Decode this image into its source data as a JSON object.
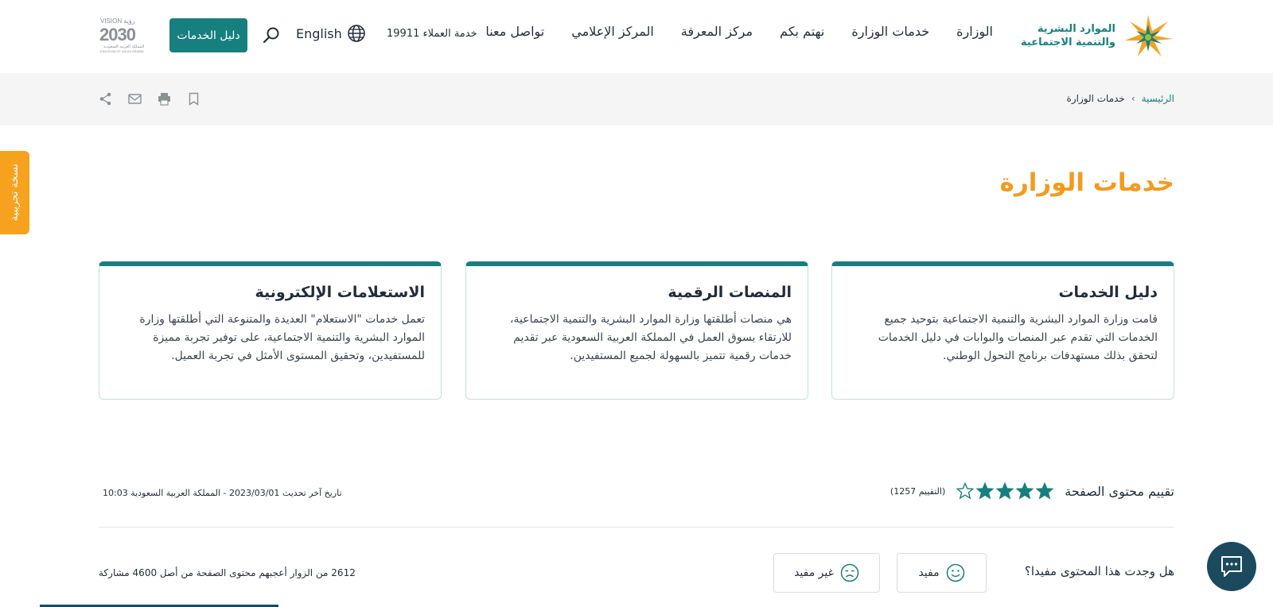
{
  "header": {
    "logo": {
      "line1": "الموارد البشرية",
      "line2": "والتنمية الاجتماعية"
    },
    "nav": [
      "الوزارة",
      "خدمات الوزارة",
      "نهتم بكم",
      "مركز المعرفة",
      "المركز الإعلامي",
      "تواصل معنا"
    ],
    "hotline": "خدمة العملاء 19911",
    "language_label": "English",
    "services_button": "دليل الخدمات",
    "vision_logo": {
      "top": "VISION رؤية",
      "year": "2030",
      "caption": "المملكة العربية السعودية",
      "caption_en": "KINGDOM OF SAUDI ARABIA"
    }
  },
  "breadcrumb": {
    "home": "الرئيسية",
    "separator": "›",
    "current": "خدمات الوزارة"
  },
  "actions": {
    "icons": [
      "bookmark-icon",
      "print-icon",
      "email-icon",
      "share-icon"
    ]
  },
  "trial_tab": "نسخة تجريبية",
  "page_title": "خدمات الوزارة",
  "cards": [
    {
      "title": "دليل الخدمات",
      "body": "قامت وزارة الموارد البشرية والتنمية الاجتماعية بتوحيد جميع الخدمات التي تقدم عبر المنصات والبوابات في دليل الخدمات لتحقق بذلك مستهدفات برنامج التحول الوطني."
    },
    {
      "title": "المنصات الرقمية",
      "body": "هي منصات أطلقتها وزارة الموارد البشرية والتنمية الاجتماعية، للارتقاء بسوق العمل في المملكة العربية السعودية عبر تقديم خدمات رقمية تتميز بالسهولة لجميع المستفيدين."
    },
    {
      "title": "الاستعلامات الإلكترونية",
      "body": "تعمل خدمات \"الاستعلام\" العديدة والمتنوعة التي أطلقتها وزارة الموارد البشرية والتنمية الاجتماعية، على توفير تجربة مميزة للمستفيدين، وتحقيق المستوى الأمثل في تجربة العميل."
    }
  ],
  "rating": {
    "label": "تقييم محتوى الصفحة",
    "value": 4,
    "max": 5,
    "count_text": "(التقييم 1257)"
  },
  "last_updated": "تاريخ آخر تحديث  2023/03/01  - المملكة العربية السعودية  10:03",
  "feedback": {
    "question": "هل وجدت هذا المحتوى مفيدا؟",
    "useful": "مفيد",
    "not_useful": "غير مفيد",
    "visitors_text": "2612 من الزوار أعجبهم محتوى الصفحة من أصل 4600 مشاركة"
  },
  "colors": {
    "primary": "#17807e",
    "accent": "#f39a1f",
    "chat": "#1b4a5e",
    "trial": "#f6a21e"
  }
}
